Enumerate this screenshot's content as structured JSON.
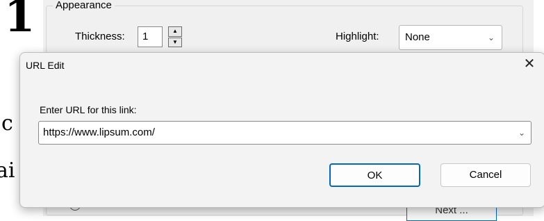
{
  "background": {
    "group_title": "Appearance",
    "thickness_label": "Thickness:",
    "thickness_value": "1",
    "highlight_label": "Highlight:",
    "highlight_value": "None",
    "next_button_label": "Next ...",
    "glyph_top": "1",
    "glyph_mid": "c",
    "glyph_low": "ai"
  },
  "dialog": {
    "title": "URL Edit",
    "close_glyph": "✕",
    "prompt": "Enter URL for this link:",
    "url_value": "https://www.lipsum.com/",
    "ok_label": "OK",
    "cancel_label": "Cancel"
  },
  "icons": {
    "chevron": "⌄",
    "spin_up": "▲",
    "spin_down": "▼"
  }
}
